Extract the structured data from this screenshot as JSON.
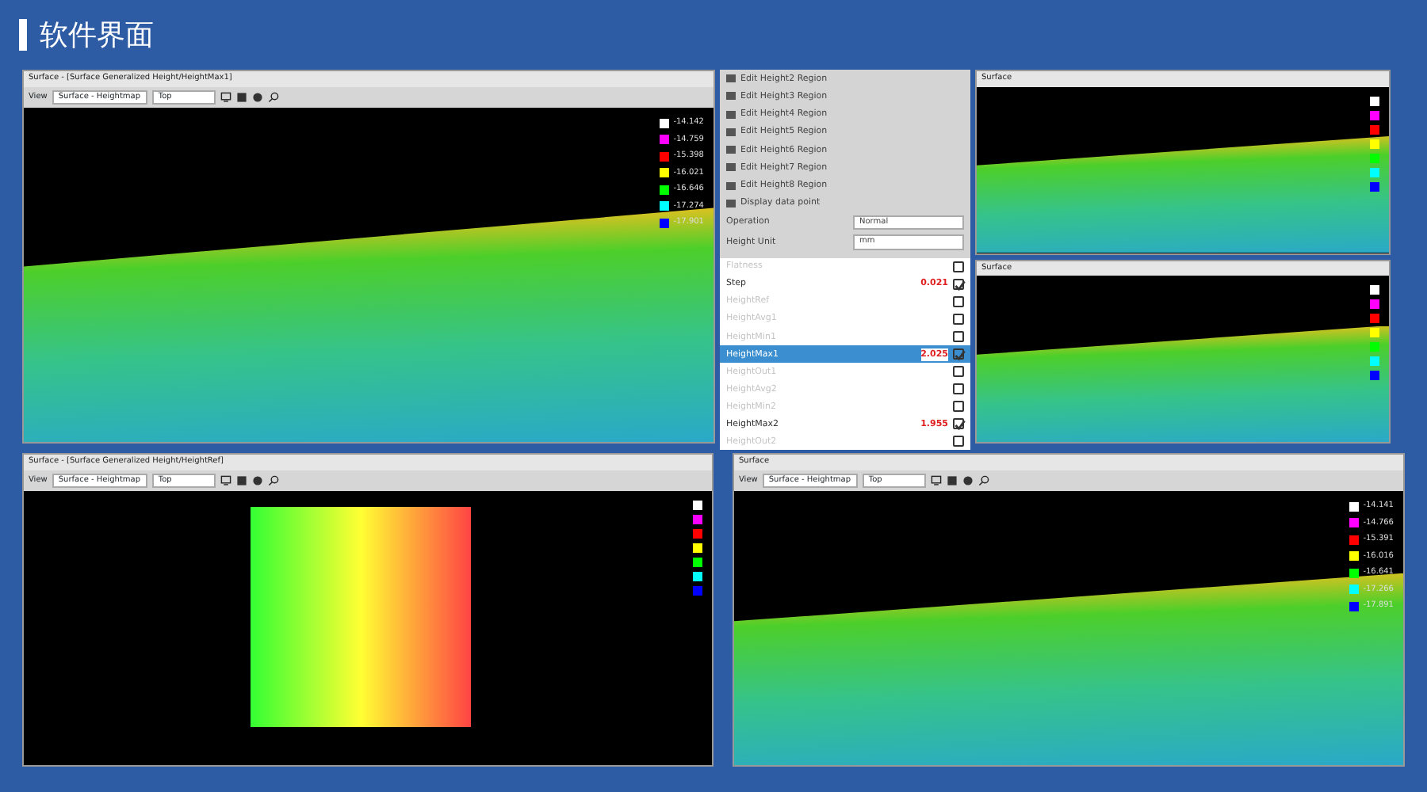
{
  "title": "软件界面",
  "windows": [
    {
      "kind": "surface",
      "title": "Surface - [Surface Generalized Height/HeightMax1]",
      "toolbar": {
        "view_label": "View",
        "view": "Surface - Heightmap",
        "orientation": "Top"
      },
      "legend": [
        {
          "color": "#ffffff",
          "value": "-14.142"
        },
        {
          "color": "#ff00ff",
          "value": "-14.759"
        },
        {
          "color": "#ff0000",
          "value": "-15.398"
        },
        {
          "color": "#ffff00",
          "value": "-16.021"
        },
        {
          "color": "#00ff00",
          "value": "-16.646"
        },
        {
          "color": "#00ffff",
          "value": "-17.274"
        },
        {
          "color": "#0000ff",
          "value": "-17.901"
        }
      ]
    },
    {
      "kind": "surface",
      "title": "Surface",
      "legend": [
        {
          "color": "#ffffff"
        },
        {
          "color": "#ff00ff"
        },
        {
          "color": "#ff0000"
        },
        {
          "color": "#ffff00"
        },
        {
          "color": "#00ff00"
        },
        {
          "color": "#00ffff"
        },
        {
          "color": "#0000ff"
        }
      ]
    },
    {
      "kind": "surface",
      "title": "Surface",
      "legend": [
        {
          "color": "#ffffff"
        },
        {
          "color": "#ff00ff"
        },
        {
          "color": "#ff0000"
        },
        {
          "color": "#ffff00"
        },
        {
          "color": "#00ff00"
        },
        {
          "color": "#00ffff"
        },
        {
          "color": "#0000ff"
        }
      ]
    },
    {
      "kind": "heatmap",
      "title": "Surface - [Surface Generalized Height/HeightRef]",
      "toolbar": {
        "view_label": "View",
        "view": "Surface - Heightmap",
        "orientation": "Top"
      },
      "legend": [
        {
          "color": "#ffffff"
        },
        {
          "color": "#ff00ff"
        },
        {
          "color": "#ff0000"
        },
        {
          "color": "#ffff00"
        },
        {
          "color": "#00ff00"
        },
        {
          "color": "#00ffff"
        },
        {
          "color": "#0000ff"
        }
      ]
    },
    {
      "kind": "surface",
      "title": "Surface",
      "toolbar": {
        "view_label": "View",
        "view": "Surface - Heightmap",
        "orientation": "Top"
      },
      "legend": [
        {
          "color": "#ffffff",
          "value": "-14.141"
        },
        {
          "color": "#ff00ff",
          "value": "-14.766"
        },
        {
          "color": "#ff0000",
          "value": "-15.391"
        },
        {
          "color": "#ffff00",
          "value": "-16.016"
        },
        {
          "color": "#00ff00",
          "value": "-16.641"
        },
        {
          "color": "#00ffff",
          "value": "-17.266"
        },
        {
          "color": "#0000ff",
          "value": "-17.891"
        }
      ]
    }
  ],
  "panel": {
    "actions": [
      "Edit Height2 Region",
      "Edit Height3 Region",
      "Edit Height4 Region",
      "Edit Height5 Region",
      "Edit Height6 Region",
      "Edit Height7 Region",
      "Edit Height8 Region",
      "Display data point"
    ],
    "settings": [
      {
        "label": "Operation",
        "value": "Normal"
      },
      {
        "label": "Height Unit",
        "value": "mm"
      }
    ],
    "measurements": [
      {
        "name": "Flatness",
        "disabled": true,
        "checked": false,
        "selected": false
      },
      {
        "name": "Step",
        "value": "0.021",
        "disabled": false,
        "checked": true,
        "selected": false
      },
      {
        "name": "HeightRef",
        "disabled": true,
        "checked": false,
        "selected": false
      },
      {
        "name": "HeightAvg1",
        "disabled": true,
        "checked": false,
        "selected": false
      },
      {
        "name": "HeightMin1",
        "disabled": true,
        "checked": false,
        "selected": false
      },
      {
        "name": "HeightMax1",
        "value": "2.025",
        "disabled": false,
        "checked": true,
        "selected": true
      },
      {
        "name": "HeightOut1",
        "disabled": true,
        "checked": false,
        "selected": false
      },
      {
        "name": "HeightAvg2",
        "disabled": true,
        "checked": false,
        "selected": false
      },
      {
        "name": "HeightMin2",
        "disabled": true,
        "checked": false,
        "selected": false
      },
      {
        "name": "HeightMax2",
        "value": "1.955",
        "disabled": false,
        "checked": true,
        "selected": false
      },
      {
        "name": "HeightOut2",
        "disabled": true,
        "checked": false,
        "selected": false
      }
    ]
  }
}
